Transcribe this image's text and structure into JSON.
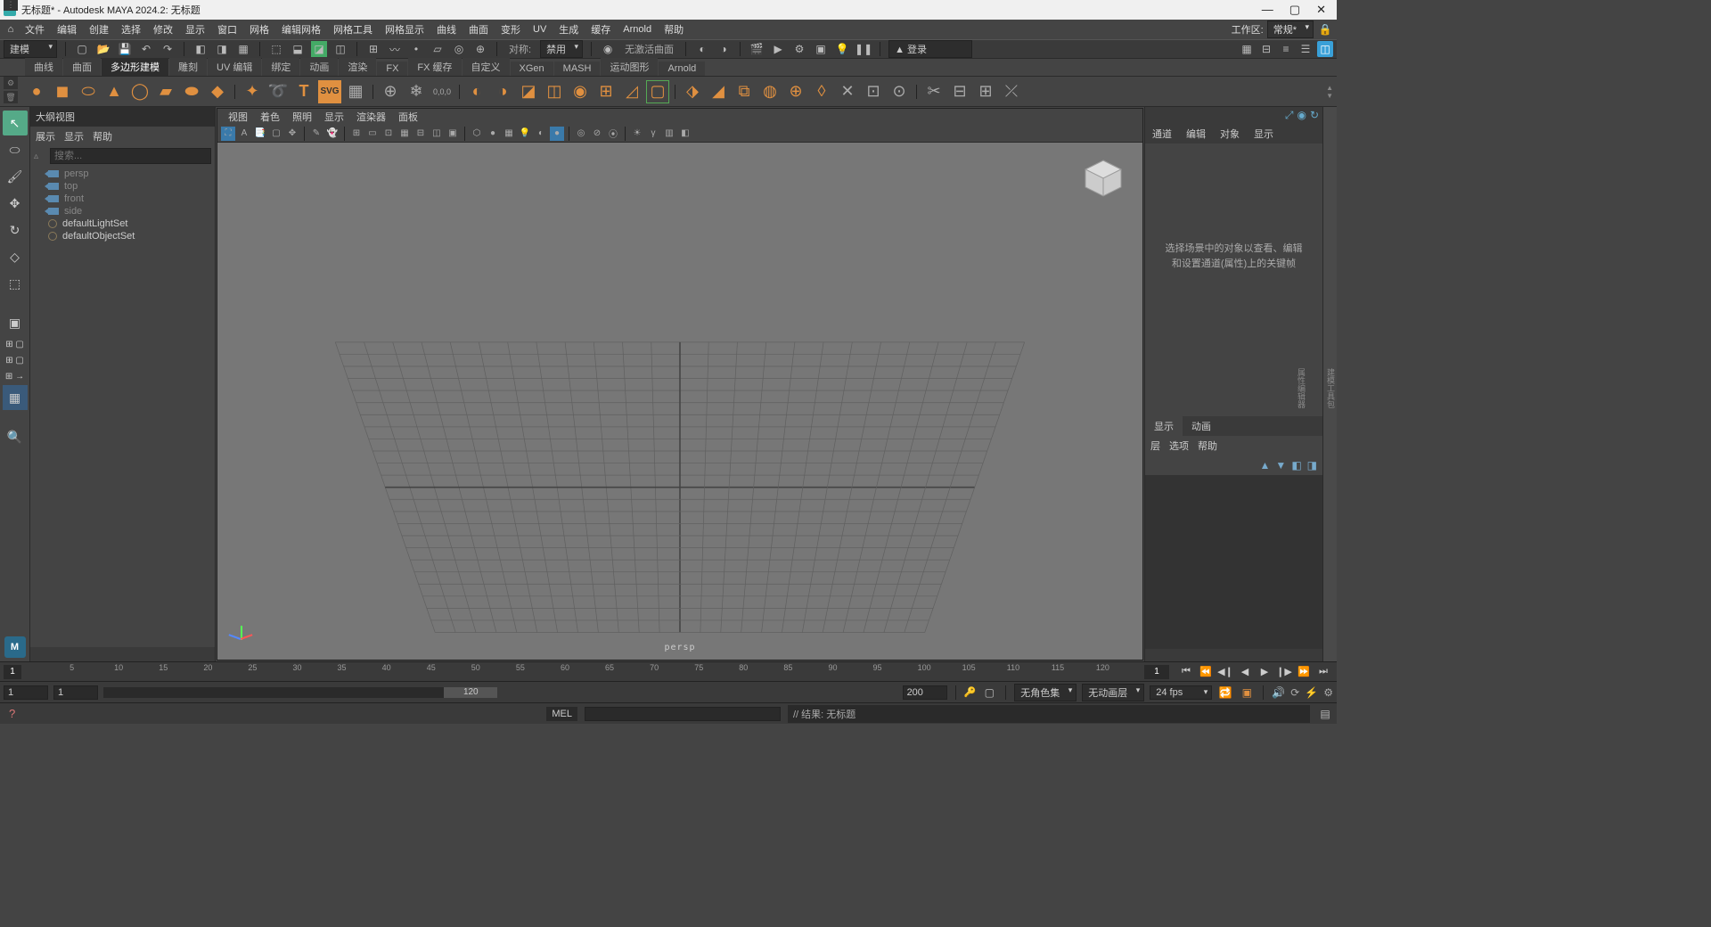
{
  "title": "无标题* - Autodesk MAYA 2024.2: 无标题",
  "menubar": [
    "文件",
    "编辑",
    "创建",
    "选择",
    "修改",
    "显示",
    "窗口",
    "网格",
    "编辑网格",
    "网格工具",
    "网格显示",
    "曲线",
    "曲面",
    "变形",
    "UV",
    "生成",
    "缓存",
    "Arnold",
    "帮助"
  ],
  "workspace": {
    "label": "工作区:",
    "value": "常规*"
  },
  "statusline": {
    "mode": "建模",
    "symmetry_label": "对称:",
    "symmetry_value": "禁用",
    "no_active": "无激活曲面",
    "login": "▲ 登录"
  },
  "shelf_tabs": [
    "曲线",
    "曲面",
    "多边形建模",
    "雕刻",
    "UV 编辑",
    "绑定",
    "动画",
    "渲染",
    "FX",
    "FX 缓存",
    "自定义",
    "XGen",
    "MASH",
    "运动图形",
    "Arnold"
  ],
  "shelf_active": "多边形建模",
  "outliner": {
    "title": "大纲视图",
    "menu": [
      "展示",
      "显示",
      "帮助"
    ],
    "search_placeholder": "搜索...",
    "nodes": [
      {
        "type": "cam",
        "label": "persp"
      },
      {
        "type": "cam",
        "label": "top"
      },
      {
        "type": "cam",
        "label": "front"
      },
      {
        "type": "cam",
        "label": "side"
      },
      {
        "type": "set",
        "label": "defaultLightSet"
      },
      {
        "type": "set",
        "label": "defaultObjectSet"
      }
    ]
  },
  "viewport": {
    "menu": [
      "视图",
      "着色",
      "照明",
      "显示",
      "渲染器",
      "面板"
    ],
    "camera_label": "persp"
  },
  "channelbox": {
    "tabs": [
      "通道",
      "编辑",
      "对象",
      "显示"
    ],
    "placeholder": "选择场景中的对象以查看、编辑和设置通道(属性)上的关键帧",
    "layer_tabs": [
      "显示",
      "动画"
    ],
    "layer_menu": [
      "层",
      "选项",
      "帮助"
    ]
  },
  "timeline": {
    "ticks": [
      5,
      10,
      15,
      20,
      25,
      30,
      35,
      40,
      45,
      50,
      55,
      60,
      65,
      70,
      75,
      80,
      85,
      90,
      95,
      100,
      105,
      110,
      115,
      120
    ],
    "current": 1
  },
  "range": {
    "start": "1",
    "inner_start": "1",
    "inner_end": "120",
    "end": "200",
    "char_set": "无角色集",
    "anim_layer": "无动画层",
    "fps": "24 fps"
  },
  "cmd": {
    "lang": "MEL",
    "result": "// 结果: 无标题"
  }
}
